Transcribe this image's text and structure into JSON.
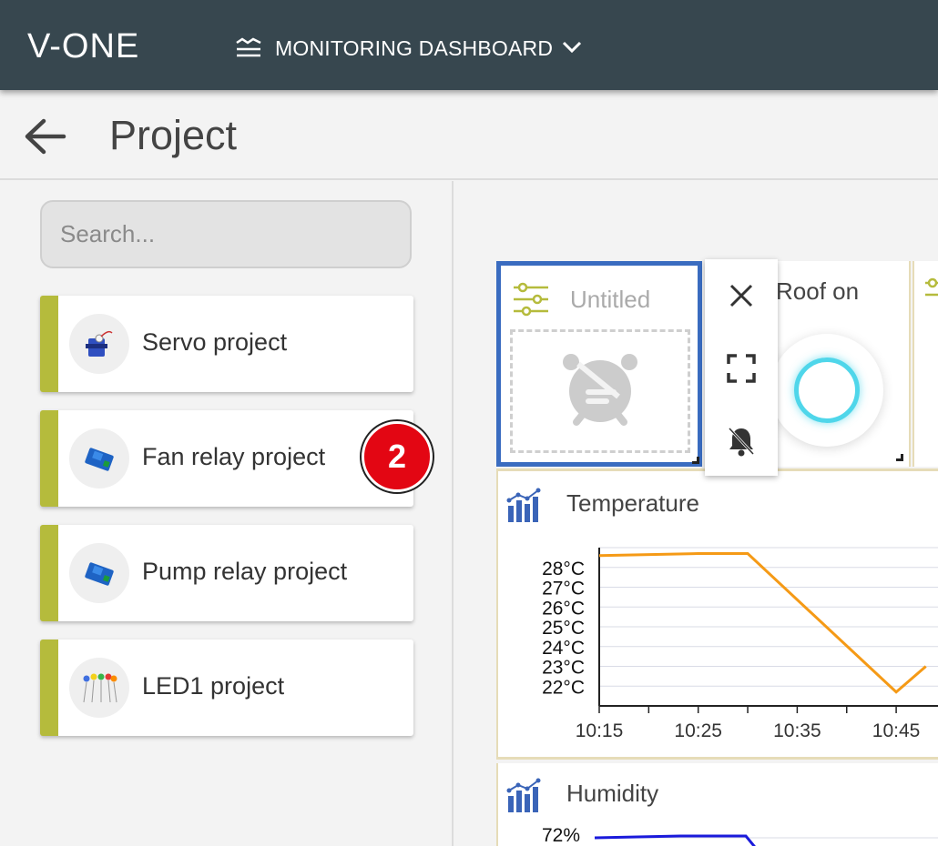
{
  "app": {
    "logo": "V-ONE",
    "dashboard_menu_label": "MONITORING DASHBOARD"
  },
  "header": {
    "title": "Project"
  },
  "sidebar": {
    "search_placeholder": "Search...",
    "projects": [
      {
        "name": "Servo project"
      },
      {
        "name": "Fan relay project",
        "badge": "2"
      },
      {
        "name": "Pump relay project"
      },
      {
        "name": "LED1 project"
      }
    ],
    "accent_color": "#b5bb3c"
  },
  "widgets": {
    "untitled": {
      "title": "Untitled"
    },
    "roof": {
      "title": "Roof on"
    },
    "temperature": {
      "title": "Temperature"
    },
    "humidity": {
      "title": "Humidity",
      "ytick_top": "72%"
    }
  },
  "chart_data": [
    {
      "type": "line",
      "title": "Temperature",
      "x": [
        "10:15",
        "10:25",
        "10:30",
        "10:35",
        "10:45",
        "10:48"
      ],
      "series": [
        {
          "values": [
            28.6,
            28.7,
            28.7,
            null,
            21.7,
            23.0
          ],
          "color": "#f59a16"
        }
      ],
      "x_ticks": [
        "10:15",
        "10:25",
        "10:35",
        "10:45"
      ],
      "y_ticks": [
        "28°C",
        "27°C",
        "26°C",
        "25°C",
        "24°C",
        "23°C",
        "22°C"
      ],
      "ylim": [
        21,
        29
      ],
      "grid": true
    },
    {
      "type": "line",
      "title": "Humidity",
      "y_ticks": [
        "72%"
      ],
      "series": [
        {
          "values": [
            72,
            72.2,
            72.2,
            70
          ],
          "color": "#1a1adb"
        }
      ]
    }
  ]
}
